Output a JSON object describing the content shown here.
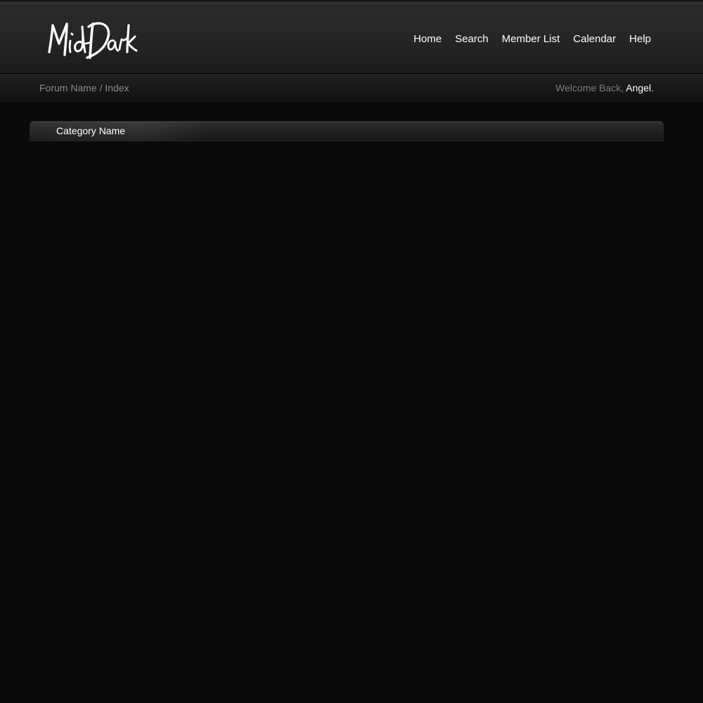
{
  "header": {
    "logo_icon": "signature-logo-icon",
    "nav": [
      {
        "label": "Home"
      },
      {
        "label": "Search"
      },
      {
        "label": "Member List"
      },
      {
        "label": "Calendar"
      },
      {
        "label": "Help"
      }
    ]
  },
  "subbar": {
    "breadcrumb": "Forum Name / Index",
    "welcome_prefix": "Welcome Back, ",
    "username": "Angel",
    "welcome_suffix": "."
  },
  "category": {
    "title": "Category Name"
  },
  "colors": {
    "background": "#0a0a0a",
    "header": "#262626",
    "nav_text": "#ffffff",
    "muted_text": "#8a8a8a"
  }
}
